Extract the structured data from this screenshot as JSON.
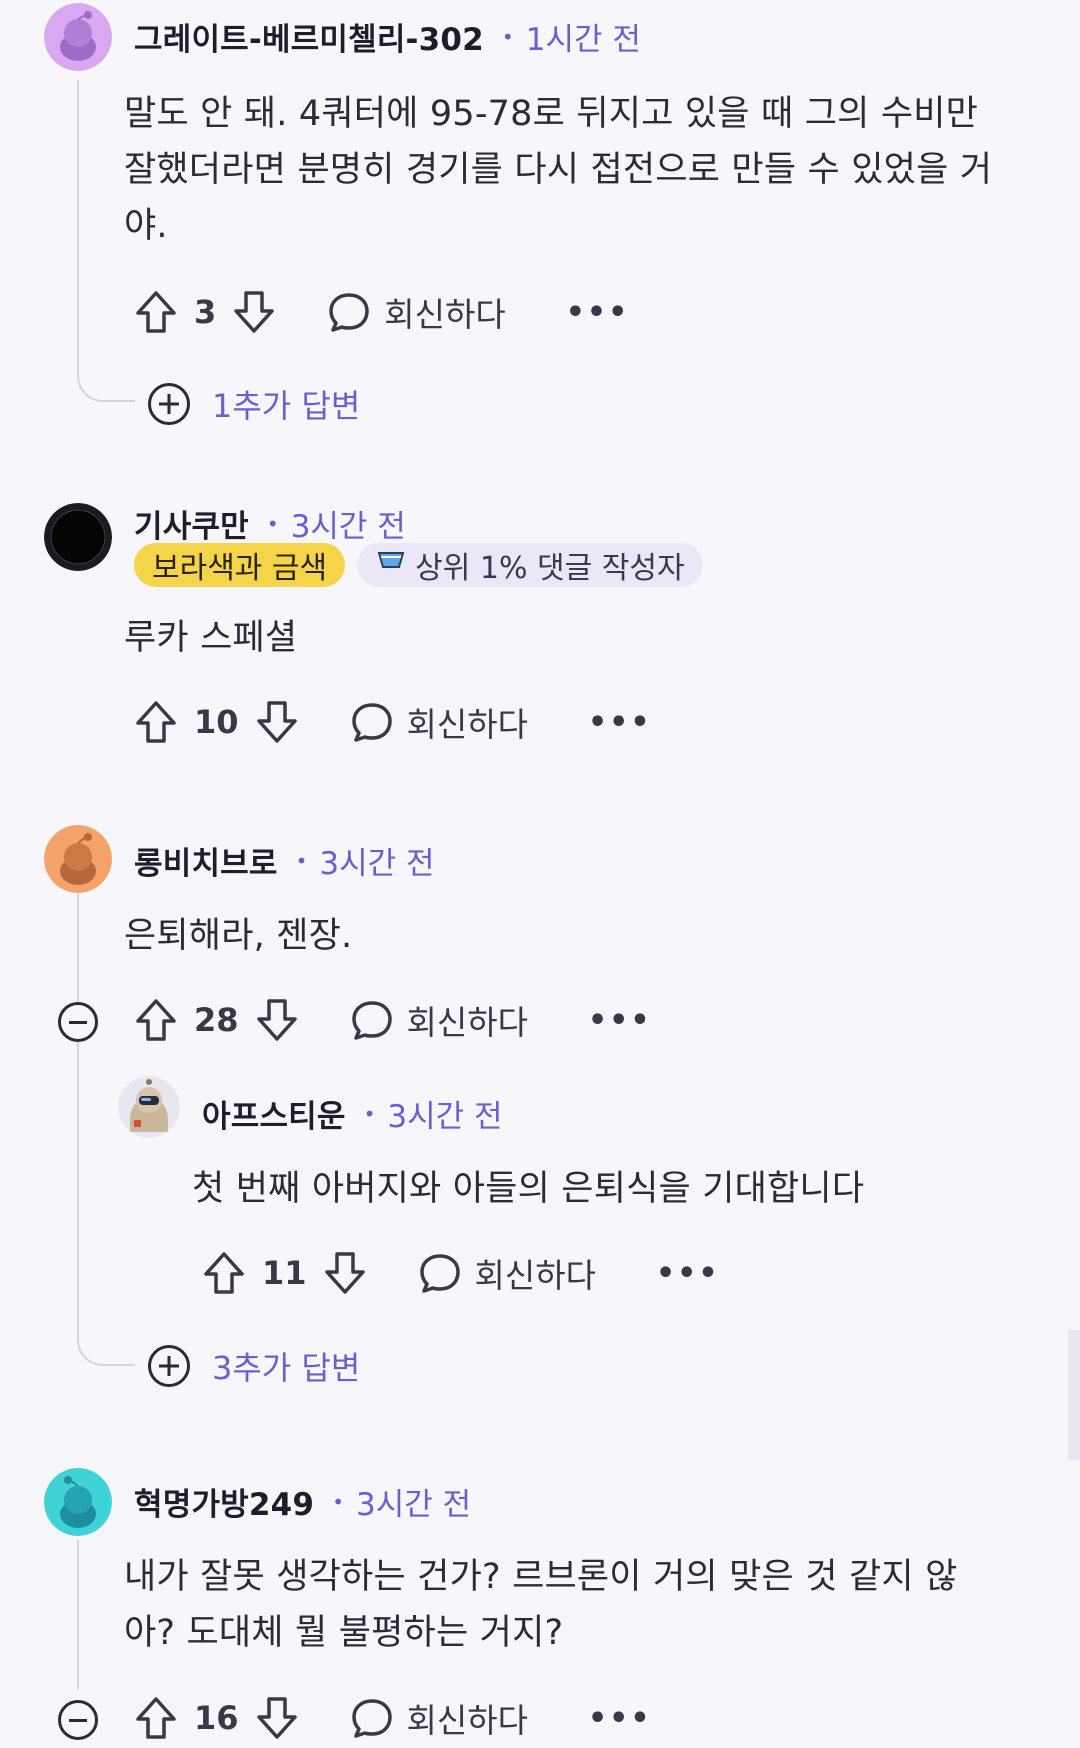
{
  "comments": [
    {
      "username": "그레이트-베르미첼리-302",
      "dot": "•",
      "time": "1시간 전",
      "avatar_color": "#d9a8f0",
      "body_lines": [
        "말도 안 돼. 4쿼터에 95-78로 뒤지고 있을 때 그의 수비만",
        "잘했더라면 분명히 경기를 다시 접전으로 만들 수 있었을 거",
        "야."
      ],
      "votes": "3",
      "reply_label": "회신하다",
      "more": "•••",
      "more_replies": "1추가 답변"
    },
    {
      "username": "기사쿠만",
      "dot": "•",
      "time": "3시간 전",
      "avatar_color": "#0a0a0a",
      "flairs": [
        "보라색과 금색",
        "상위 1% 댓글 작성자"
      ],
      "body_lines": [
        "루카 스페셜"
      ],
      "votes": "10",
      "reply_label": "회신하다",
      "more": "•••"
    },
    {
      "username": "롱비치브로",
      "dot": "•",
      "time": "3시간 전",
      "avatar_color": "#f4a46a",
      "body_lines": [
        "은퇴해라, 젠장."
      ],
      "votes": "28",
      "reply_label": "회신하다",
      "more": "•••",
      "reply": {
        "username": "아프스티운",
        "dot": "•",
        "time": "3시간 전",
        "body_lines": [
          "첫 번째 아버지와 아들의 은퇴식을 기대합니다"
        ],
        "votes": "11",
        "reply_label": "회신하다",
        "more": "•••"
      },
      "more_replies": "3추가 답변"
    },
    {
      "username": "혁명가방249",
      "dot": "•",
      "time": "3시간 전",
      "avatar_color": "#3fd3d8",
      "body_lines": [
        "내가 잘못 생각하는 건가? 르브론이 거의 맞은 것 같지 않",
        "아? 도대체 뭘 불평하는 거지?"
      ],
      "votes": "16",
      "reply_label": "회신하다",
      "more": "•••"
    }
  ],
  "colors": {
    "accent": "#6a5fd0",
    "background": "#f7f6fb",
    "flair_gold": "#f6d44a",
    "flair_purple": "#ebe7f6"
  },
  "icons": [
    "upvote-icon",
    "downvote-icon",
    "comment-bubble-icon",
    "more-options-icon",
    "collapse-icon",
    "expand-plus-icon",
    "sunglasses-badge-icon"
  ]
}
